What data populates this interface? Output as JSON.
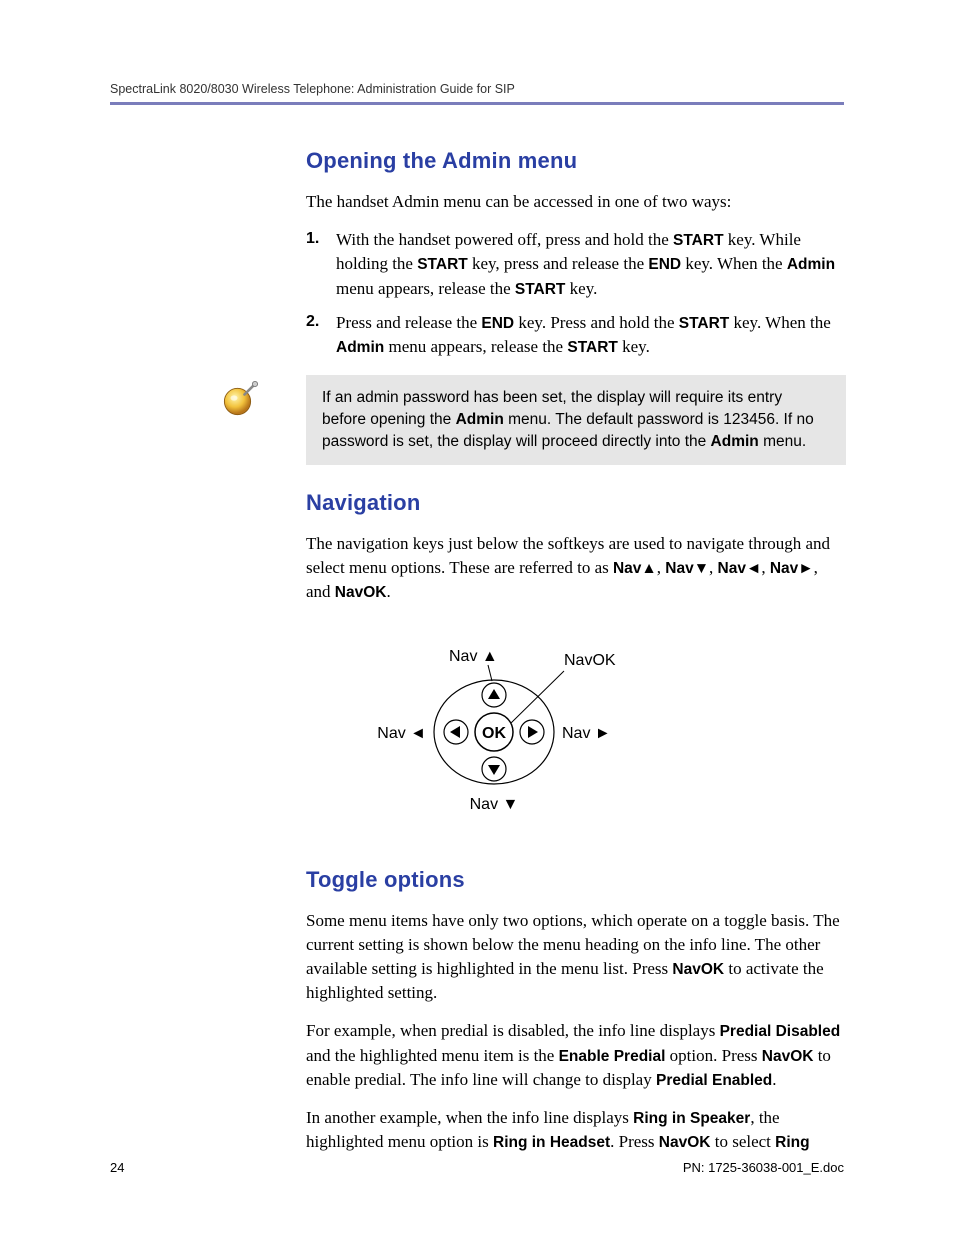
{
  "header": {
    "running_title": "SpectraLink 8020/8030 Wireless Telephone: Administration Guide for SIP"
  },
  "sections": {
    "opening": {
      "heading": "Opening the Admin menu",
      "intro": "The handset Admin menu can be accessed in one of two ways:",
      "step1_a": "With the handset powered off, press and hold the ",
      "step1_b": " key. While holding the ",
      "step1_c": " key, press and release the ",
      "step1_d": " key.  When the ",
      "step1_e": " menu appears, release the ",
      "step1_f": " key.",
      "step2_a": "Press and release the ",
      "step2_b": " key.  Press and hold the ",
      "step2_c": " key. When the ",
      "step2_d": " menu appears, release the ",
      "step2_e": " key.",
      "k_start": "START",
      "k_end": "END",
      "k_admin": "Admin"
    },
    "note": {
      "a": "If an admin password has been set, the display will require its entry before opening the ",
      "b": " menu. The default password is 123456. If no password is set, the display will proceed directly into the ",
      "c": " menu.",
      "admin": "Admin"
    },
    "navigation": {
      "heading": "Navigation",
      "p1_a": "The navigation keys just below the softkeys are used to navigate through and select menu options. These are referred to as ",
      "nav_up": "Nav▲",
      "sep1": ", ",
      "nav_down": "Nav▼",
      "sep2": ", ",
      "nav_left": "Nav◄",
      "sep3": ", ",
      "nav_right": "Nav►",
      "sep4": ", and ",
      "nav_ok": "NavOK",
      "p1_end": ".",
      "dia": {
        "up": "Nav ▲",
        "down": "Nav ▼",
        "left": "Nav ◄",
        "right": "Nav ►",
        "ok": "NavOK",
        "center": "OK"
      }
    },
    "toggle": {
      "heading": "Toggle options",
      "p1_a": "Some menu items have only two options, which operate on a toggle basis. The current setting is shown below the menu heading on the info line. The other available setting is highlighted in the menu list. Press ",
      "p1_b": " to activate the highlighted setting.",
      "p2_a": "For example, when predial is disabled, the info line displays ",
      "predial_disabled": "Predial Disabled",
      "p2_b": " and the highlighted menu item is the ",
      "enable_predial": "Enable Predial",
      "p2_c": " option. Press ",
      "p2_d": " to enable predial. The info line will change to display ",
      "predial_enabled": "Predial Enabled",
      "p2_e": ".",
      "p3_a": "In another example, when the info line displays ",
      "ring_speaker": "Ring in Speaker",
      "p3_b": ", the highlighted menu option is ",
      "ring_headset": "Ring in Headset",
      "p3_c": ". Press ",
      "p3_d": " to select ",
      "ring": "Ring",
      "navok": "NavOK"
    }
  },
  "footer": {
    "page": "24",
    "pn": "PN: 1725-36038-001_E.doc"
  }
}
